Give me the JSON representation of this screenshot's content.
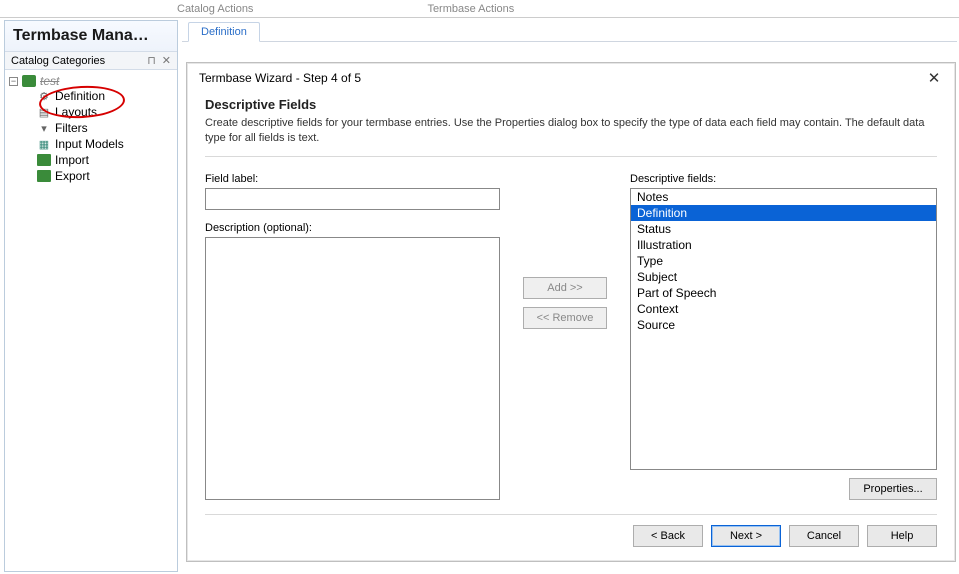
{
  "toolbar": {
    "catalog_actions": "Catalog Actions",
    "termbase_actions": "Termbase Actions"
  },
  "left_panel": {
    "title": "Termbase Mana…",
    "catalog_categories": "Catalog Categories",
    "pin_glyph": "⊓",
    "close_glyph": "✕",
    "root_label": "test",
    "items": [
      {
        "label": "Definition",
        "icon": "gear"
      },
      {
        "label": "Layouts",
        "icon": "layout"
      },
      {
        "label": "Filters",
        "icon": "filter"
      },
      {
        "label": "Input Models",
        "icon": "models"
      },
      {
        "label": "Import",
        "icon": "import"
      },
      {
        "label": "Export",
        "icon": "export"
      }
    ]
  },
  "tab": {
    "definition": "Definition"
  },
  "dialog": {
    "title": "Termbase Wizard - Step 4 of 5",
    "close_glyph": "✕",
    "heading": "Descriptive Fields",
    "description": "Create descriptive fields for your termbase entries. Use the Properties dialog box to specify the type of data each field may contain. The default data type for all fields is text.",
    "field_label": "Field label:",
    "field_value": "",
    "description_label": "Description (optional):",
    "description_value": "",
    "add": "Add >>",
    "remove": "<< Remove",
    "descr_fields_label": "Descriptive fields:",
    "fields": [
      "Notes",
      "Definition",
      "Status",
      "Illustration",
      "Type",
      "Subject",
      "Part of Speech",
      "Context",
      "Source"
    ],
    "selected_index": 1,
    "properties": "Properties...",
    "back": "< Back",
    "next": "Next >",
    "cancel": "Cancel",
    "help": "Help"
  }
}
